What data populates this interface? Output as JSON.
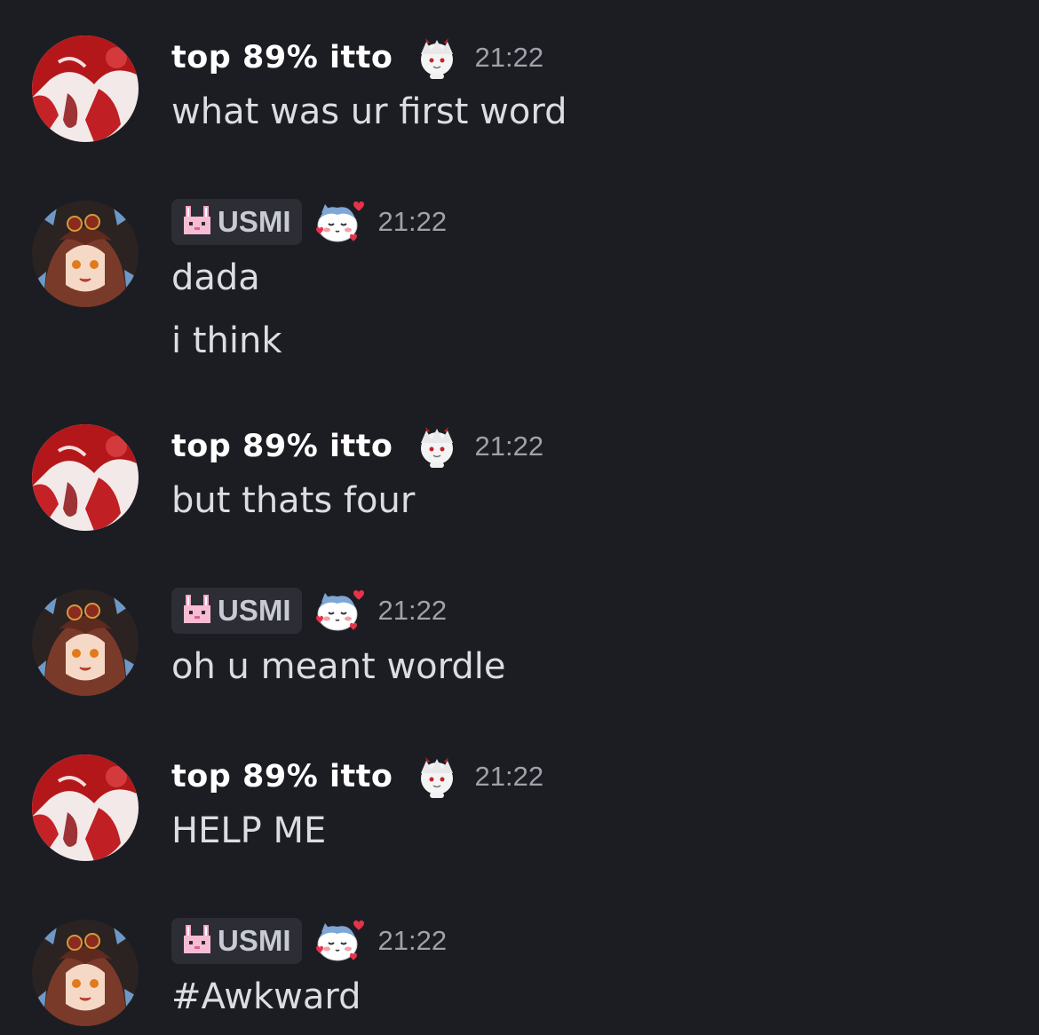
{
  "users": {
    "itto": {
      "name": "top 89% itto",
      "avatar_icon": "red-white-anime-avatar",
      "badge_icon": "white-oni-chibi-icon"
    },
    "usmi": {
      "name": "USMI",
      "tag_icon": "pink-pixel-bunny-icon",
      "avatar_icon": "brown-hair-anime-girl-avatar",
      "badge_icon": "cat-with-hearts-icon"
    }
  },
  "messages": [
    {
      "author": "top 89% itto",
      "time": "21:22",
      "lines": [
        "what was ur first word"
      ]
    },
    {
      "author": "USMI",
      "time": "21:22",
      "lines": [
        "dada",
        "i think"
      ]
    },
    {
      "author": "top 89% itto",
      "time": "21:22",
      "lines": [
        "but thats four"
      ]
    },
    {
      "author": "USMI",
      "time": "21:22",
      "lines": [
        "oh u meant wordle"
      ]
    },
    {
      "author": "top 89% itto",
      "time": "21:22",
      "lines": [
        "HELP ME"
      ]
    },
    {
      "author": "USMI",
      "time": "21:22",
      "lines": [
        "#Awkward"
      ]
    }
  ],
  "colors": {
    "background": "#1c1d22",
    "username": "#ffffff",
    "timestamp": "#9fa1ab",
    "message_text": "#dcdde2",
    "tag_background": "#2c2d35"
  }
}
